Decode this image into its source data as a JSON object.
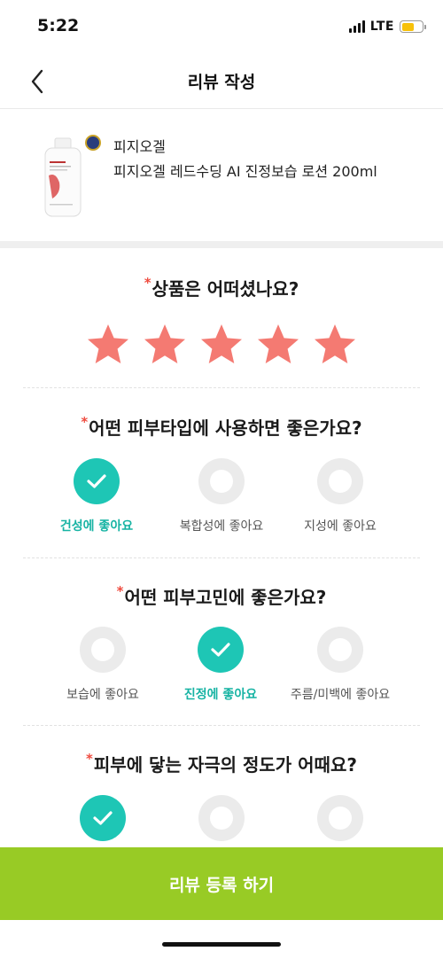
{
  "status_bar": {
    "time": "5:22",
    "network": "LTE",
    "battery_color": "#f7c10a"
  },
  "header": {
    "title": "리뷰 작성",
    "back_icon": "chevron-left-icon"
  },
  "product": {
    "brand": "피지오겔",
    "name": "피지오겔 레드수딩 AI 진정보습 로션 200ml"
  },
  "required_mark": "*",
  "rating": {
    "question": "상품은 어떠셨나요?",
    "value": 5,
    "max": 5,
    "star_color": "#f47a72"
  },
  "skin_type": {
    "question": "어떤 피부타입에 사용하면 좋은가요?",
    "options": [
      {
        "label": "건성에 좋아요",
        "selected": true
      },
      {
        "label": "복합성에 좋아요",
        "selected": false
      },
      {
        "label": "지성에 좋아요",
        "selected": false
      }
    ]
  },
  "skin_concern": {
    "question": "어떤 피부고민에 좋은가요?",
    "options": [
      {
        "label": "보습에 좋아요",
        "selected": false
      },
      {
        "label": "진정에 좋아요",
        "selected": true
      },
      {
        "label": "주름/미백에 좋아요",
        "selected": false
      }
    ]
  },
  "irritation": {
    "question": "피부에 닿는 자극의 정도가 어때요?",
    "options": [
      {
        "selected": true
      },
      {
        "selected": false
      },
      {
        "selected": false
      }
    ]
  },
  "submit": {
    "label": "리뷰 등록 하기",
    "color": "#98cb25"
  },
  "colors": {
    "accent": "#1ec6b5",
    "required": "#ef4b3f"
  }
}
